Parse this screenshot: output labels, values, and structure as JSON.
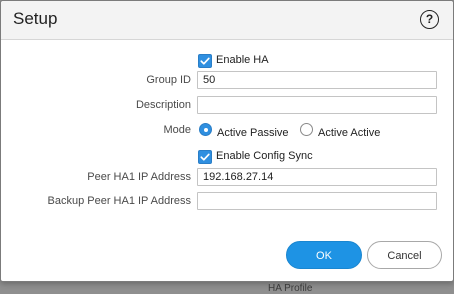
{
  "dialog": {
    "title": "Setup",
    "help_icon": "question-circle-icon",
    "help_glyph": "?"
  },
  "form": {
    "enable_ha": {
      "label": "Enable HA",
      "checked": true
    },
    "group_id": {
      "label": "Group ID",
      "value": "50"
    },
    "description": {
      "label": "Description",
      "value": ""
    },
    "mode": {
      "label": "Mode",
      "options": [
        {
          "label": "Active Passive",
          "selected": true
        },
        {
          "label": "Active Active",
          "selected": false
        }
      ]
    },
    "enable_config_sync": {
      "label": "Enable Config Sync",
      "checked": true
    },
    "peer_ha1_ip": {
      "label": "Peer HA1 IP Address",
      "value": "192.168.27.14"
    },
    "backup_peer_ha1_ip": {
      "label": "Backup Peer HA1 IP Address",
      "value": ""
    }
  },
  "buttons": {
    "ok": "OK",
    "cancel": "Cancel"
  },
  "background": {
    "partial_text": "HA Profile"
  },
  "colors": {
    "accent": "#1e93e4",
    "checkbox": "#2f8fe0",
    "backdrop": "#8f8f8f"
  }
}
